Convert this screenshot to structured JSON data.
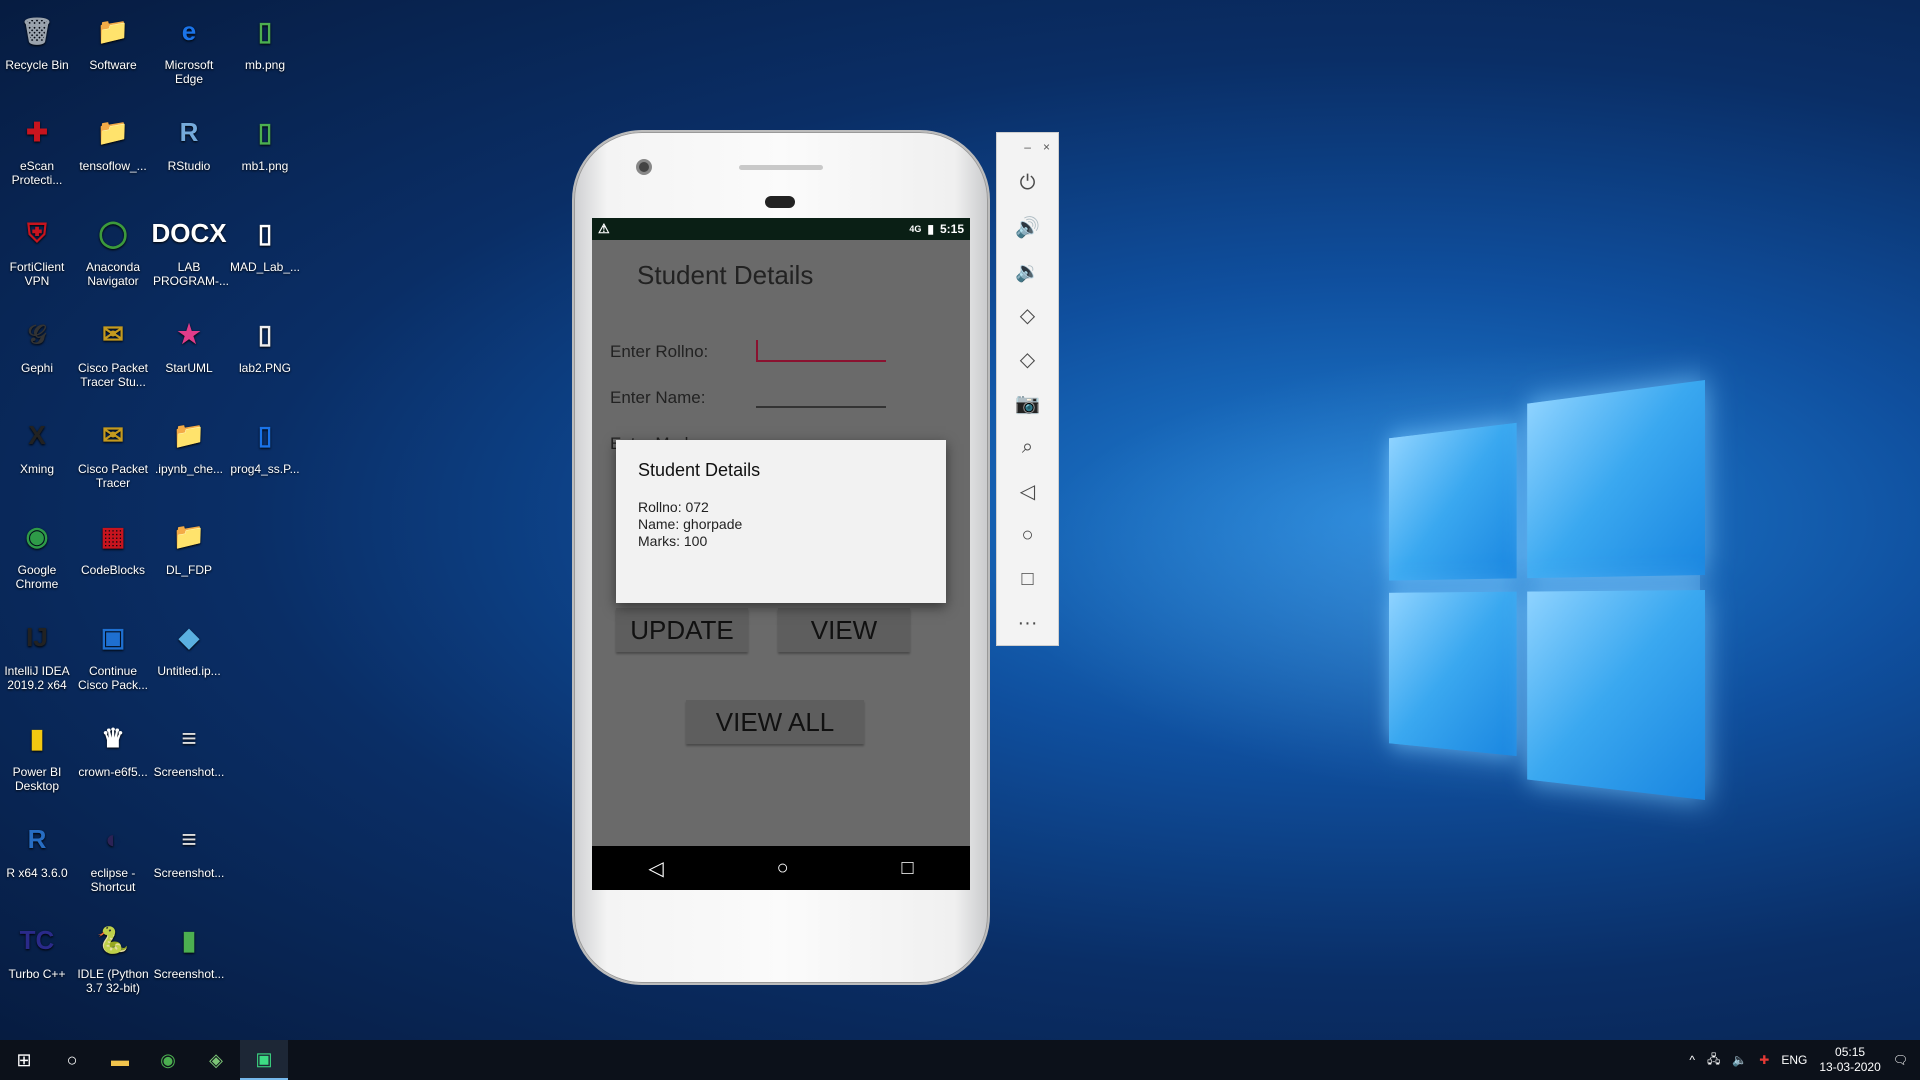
{
  "desktop": {
    "icons": [
      {
        "label": "Recycle Bin",
        "glyph": "🗑",
        "color": "#9aa3ad"
      },
      {
        "label": "eScan Protecti...",
        "glyph": "✚",
        "color": "#c8141e"
      },
      {
        "label": "FortiClient VPN",
        "glyph": "⛨",
        "color": "#c8141e"
      },
      {
        "label": "Gephi",
        "glyph": "𝒢",
        "color": "#333333"
      },
      {
        "label": "Xming",
        "glyph": "X",
        "color": "#222222"
      },
      {
        "label": "Google Chrome",
        "glyph": "◉",
        "color": "#2e9a48"
      },
      {
        "label": "IntelliJ IDEA 2019.2 x64",
        "glyph": "IJ",
        "color": "#222222"
      },
      {
        "label": "Power BI Desktop",
        "glyph": "▮",
        "color": "#f2c811"
      },
      {
        "label": "R x64 3.6.0",
        "glyph": "R",
        "color": "#276dc3"
      },
      {
        "label": "Turbo C++",
        "glyph": "TC",
        "color": "#2a2a8a"
      },
      {
        "label": "Software",
        "glyph": "📁",
        "color": "#e8c15a"
      },
      {
        "label": "tensoflow_...",
        "glyph": "📁",
        "color": "#e8c15a"
      },
      {
        "label": "Anaconda Navigator",
        "glyph": "◯",
        "color": "#3c9a3c"
      },
      {
        "label": "Cisco Packet Tracer Stu...",
        "glyph": "✉",
        "color": "#c49a1f"
      },
      {
        "label": "Cisco Packet Tracer",
        "glyph": "✉",
        "color": "#c49a1f"
      },
      {
        "label": "CodeBlocks",
        "glyph": "▦",
        "color": "#c8141e"
      },
      {
        "label": "Continue Cisco Pack...",
        "glyph": "▣",
        "color": "#1e6fd0"
      },
      {
        "label": "crown-e6f5...",
        "glyph": "♛",
        "color": "#ffffff"
      },
      {
        "label": "eclipse - Shortcut",
        "glyph": "◐",
        "color": "#2c2255"
      },
      {
        "label": "IDLE (Python 3.7 32-bit)",
        "glyph": "🐍",
        "color": "#ffffff"
      },
      {
        "label": "Microsoft Edge",
        "glyph": "e",
        "color": "#1a73e8"
      },
      {
        "label": "RStudio",
        "glyph": "R",
        "color": "#75aadb"
      },
      {
        "label": "LAB PROGRAM-...",
        "glyph": "DOCX",
        "color": "#ffffff"
      },
      {
        "label": "StarUML",
        "glyph": "★",
        "color": "#e03c8a"
      },
      {
        "label": ".ipynb_che...",
        "glyph": "📁",
        "color": "#e8c15a"
      },
      {
        "label": "DL_FDP",
        "glyph": "📁",
        "color": "#e8c15a"
      },
      {
        "label": "Untitled.ip...",
        "glyph": "◆",
        "color": "#5ab0e0"
      },
      {
        "label": "Screenshot...",
        "glyph": "≡",
        "color": "#dddddd"
      },
      {
        "label": "Screenshot...",
        "glyph": "≡",
        "color": "#dddddd"
      },
      {
        "label": "Screenshot...",
        "glyph": "▮",
        "color": "#4caf50"
      },
      {
        "label": "mb.png",
        "glyph": "▯",
        "color": "#4caf50"
      },
      {
        "label": "mb1.png",
        "glyph": "▯",
        "color": "#4caf50"
      },
      {
        "label": "MAD_Lab_...",
        "glyph": "▯",
        "color": "#ffffff"
      },
      {
        "label": "lab2.PNG",
        "glyph": "▯",
        "color": "#eeeeee"
      },
      {
        "label": "prog4_ss.P...",
        "glyph": "▯",
        "color": "#1a73e8"
      }
    ]
  },
  "phone": {
    "status": {
      "warning": "⚠",
      "signal": "4G",
      "time": "5:15"
    },
    "app_title": "Student Details",
    "labels": {
      "rollno": "Enter Rollno:",
      "name": "Enter Name:",
      "marks": "Enter Marks:"
    },
    "buttons": {
      "update": "UPDATE",
      "view": "VIEW",
      "view_all": "VIEW ALL"
    },
    "dialog": {
      "title": "Student Details",
      "rollno": "Rollno: 072",
      "name": "Name: ghorpade",
      "marks": "Marks: 100"
    }
  },
  "emulator_toolbar": {
    "minimize": "–",
    "close": "×"
  },
  "taskbar": {
    "lang": "ENG",
    "time": "05:15",
    "date": "13-03-2020"
  }
}
